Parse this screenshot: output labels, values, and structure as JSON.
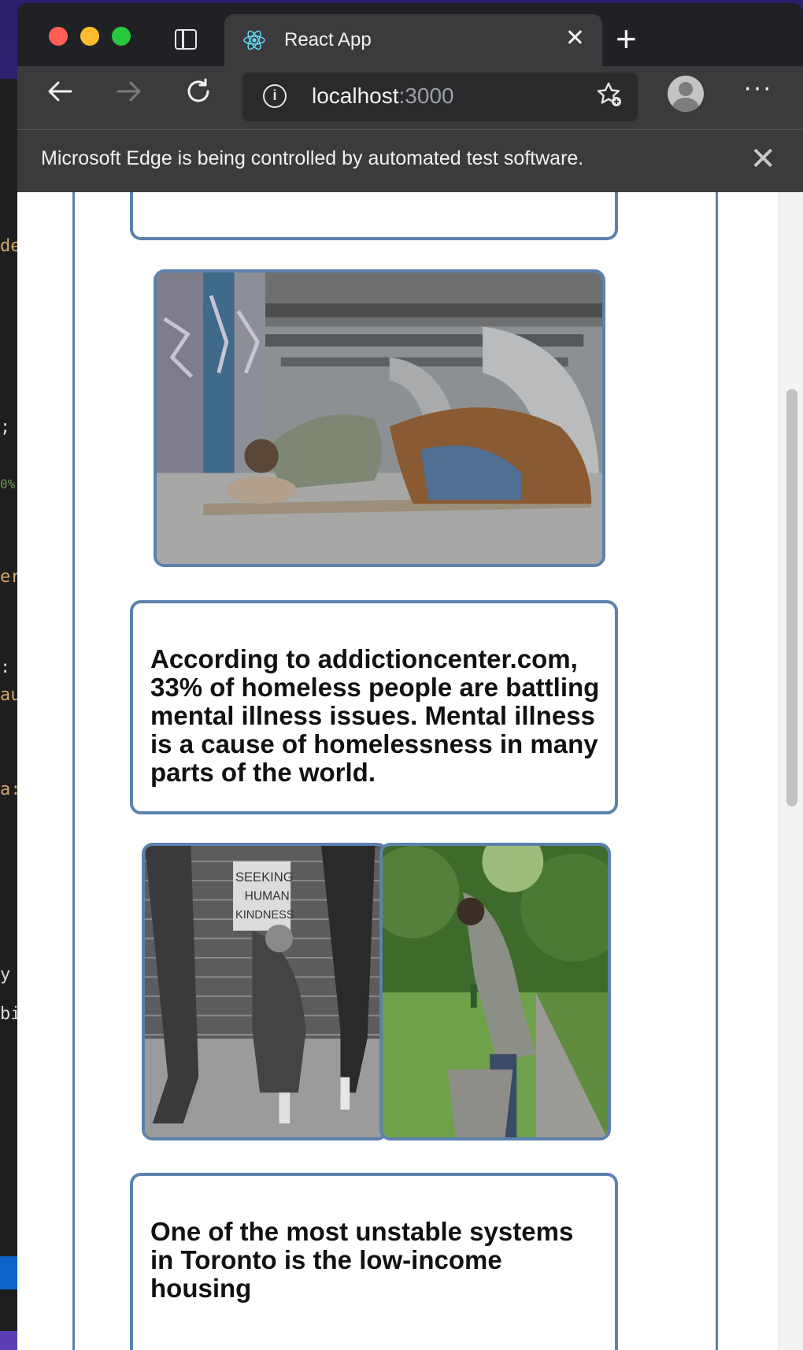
{
  "browser": {
    "tab_title": "React App",
    "close_tab_glyph": "✕",
    "new_tab_glyph": "+",
    "address_host": "localhost",
    "address_port": ":3000",
    "info_glyph": "i",
    "menu_glyph": "···",
    "infobar_message": "Microsoft Edge is being controlled by automated test software.",
    "infobar_close_glyph": "✕"
  },
  "content": {
    "image_1": {
      "alt": "Man sleeping under a bridge wrapped in a blanket"
    },
    "card_2_text": "According to addictioncenter.com, 33% of homeless people are battling mental illness issues. Mental illness is a cause of homelessness in many parts of the world.",
    "image_2": {
      "alt": "Person holding a sign reading SEEKING HUMAN KINDNESS"
    },
    "image_3": {
      "alt": "Man with a bottle bending over a trash can in a park"
    },
    "card_3_text": "One of the most unstable systems in Toronto is the low-income housing"
  },
  "colors": {
    "card_border": "#5b82ad",
    "chrome_dark": "#202124",
    "chrome_mid": "#3b3b3d"
  }
}
